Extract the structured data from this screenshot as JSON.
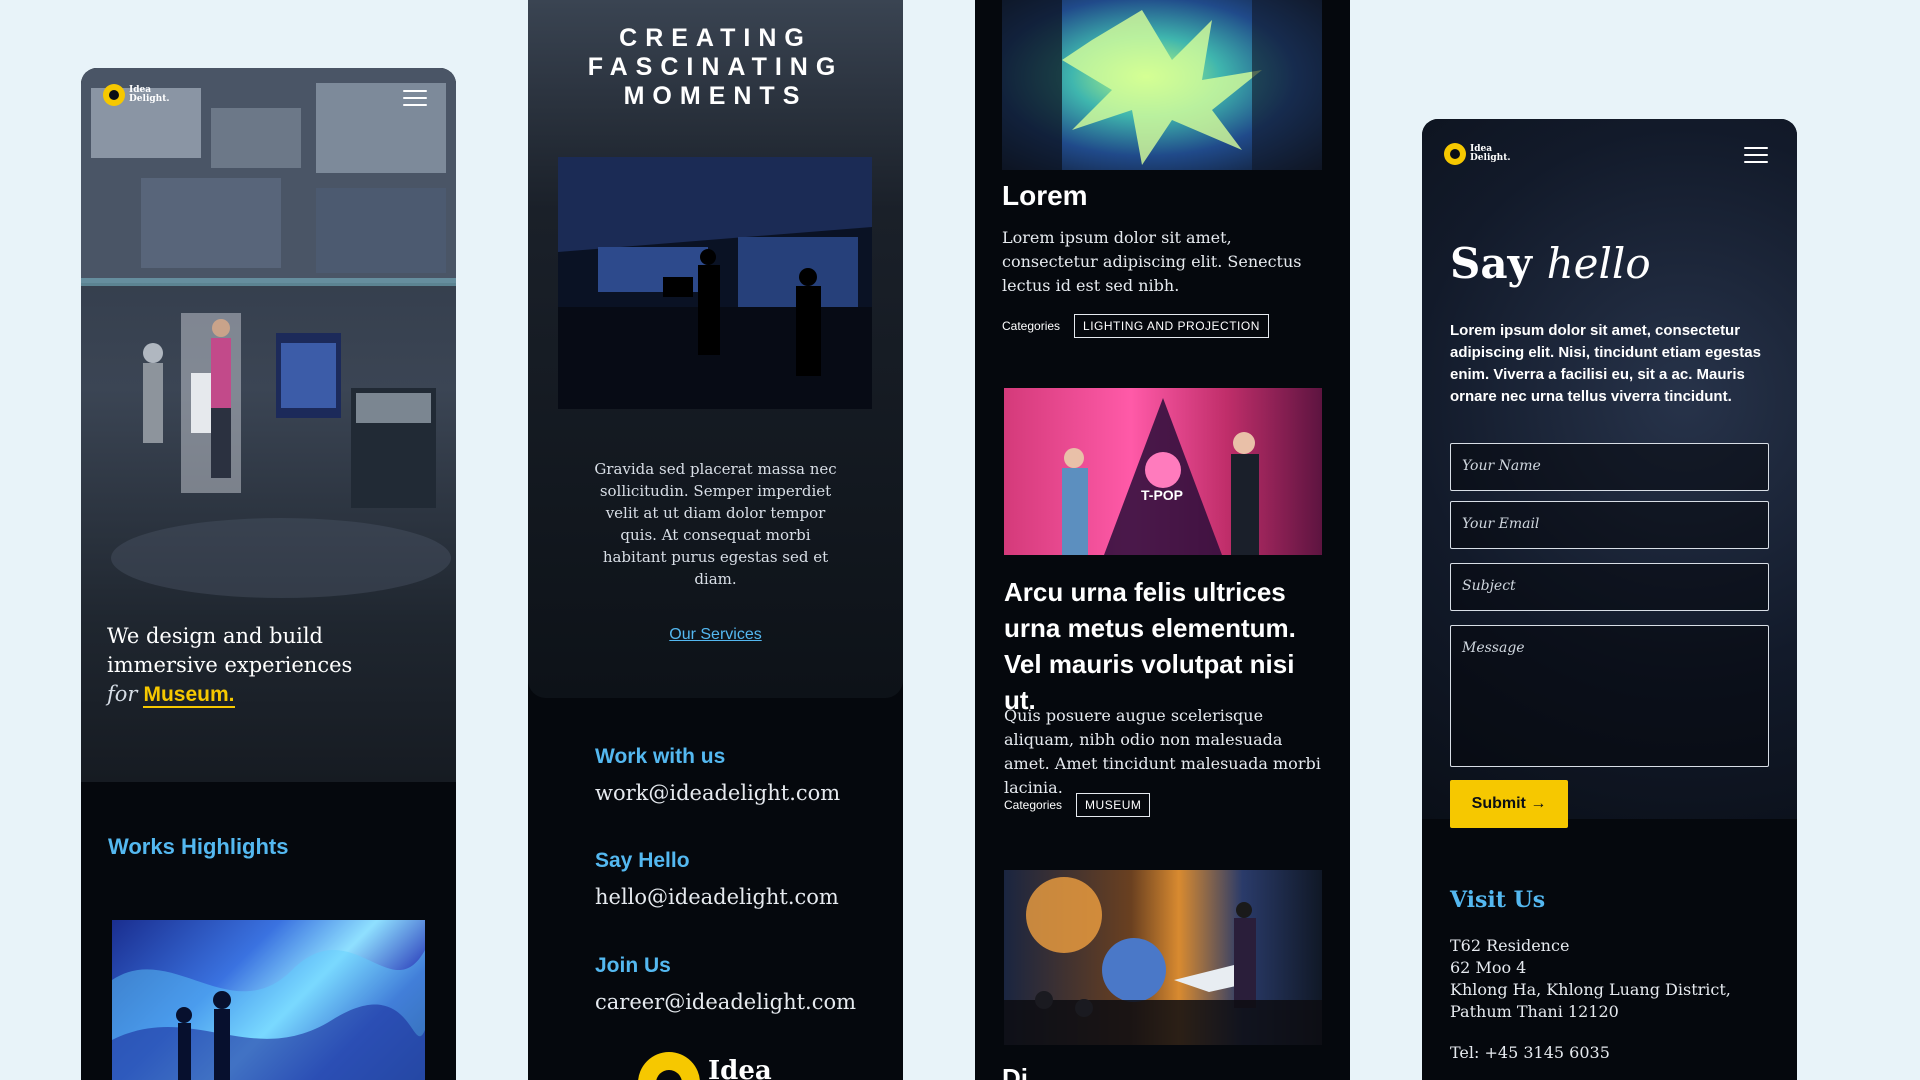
{
  "colors": {
    "background": "#e8f3f9",
    "accent_yellow": "#f6c800",
    "accent_blue": "#54b8f0",
    "dark": "#05080d"
  },
  "logo": {
    "text": "Idea\nDelight."
  },
  "footer_logo": {
    "text": "Idea"
  },
  "screen1": {
    "hero_line1": "We design and build",
    "hero_line2": "immersive experiences",
    "hero_for": "for",
    "hero_keyword": "Museum",
    "hero_period": ".",
    "works_title": "Works Highlights"
  },
  "screen2": {
    "headline": "CREATING\nFASCINATING\nMOMENTS",
    "paragraph": "Gravida sed placerat massa nec sollicitudin. Semper imperdiet velit at ut diam dolor tempor quis. At consequat morbi habitant purus egestas sed et diam.",
    "services_link": "Our Services",
    "contacts": [
      {
        "heading": "Work with us",
        "email": "work@ideadelight.com"
      },
      {
        "heading": "Say Hello",
        "email": "hello@ideadelight.com"
      },
      {
        "heading": "Join Us",
        "email": "career@ideadelight.com"
      }
    ]
  },
  "screen3": {
    "item1_title": "Lorem",
    "item1_body": "Lorem ipsum dolor sit amet, consectetur adipiscing elit. Senectus lectus id est sed nibh.",
    "categories_label": "Categories",
    "item1_tag": "LIGHTING AND PROJECTION",
    "item2_title": "Arcu urna felis ultrices urna metus elementum. Vel mauris volutpat nisi ut.",
    "item2_body": "Quis posuere augue scelerisque aliquam, nibh odio non malesuada amet. Amet tincidunt malesuada morbi lacinia.",
    "item2_tag": "MUSEUM",
    "item2_image_text": "T-POP",
    "item3_title_partial": "Di"
  },
  "screen4": {
    "title_say": "Say",
    "title_hello": "hello",
    "intro": "Lorem ipsum dolor sit amet, consectetur adipiscing elit. Nisi, tincidunt etiam egestas enim. Viverra a facilisi eu, sit a ac. Mauris ornare nec urna tellus viverra tincidunt.",
    "placeholders": {
      "name": "Your Name",
      "email": "Your Email",
      "subject": "Subject",
      "message": "Message"
    },
    "submit_label": "Submit →",
    "visit_title": "Visit Us",
    "address": "T62 Residence\n62 Moo 4\nKhlong Ha, Khlong Luang District,\nPathum Thani 12120",
    "tel": "Tel: +45 3145 6035"
  }
}
